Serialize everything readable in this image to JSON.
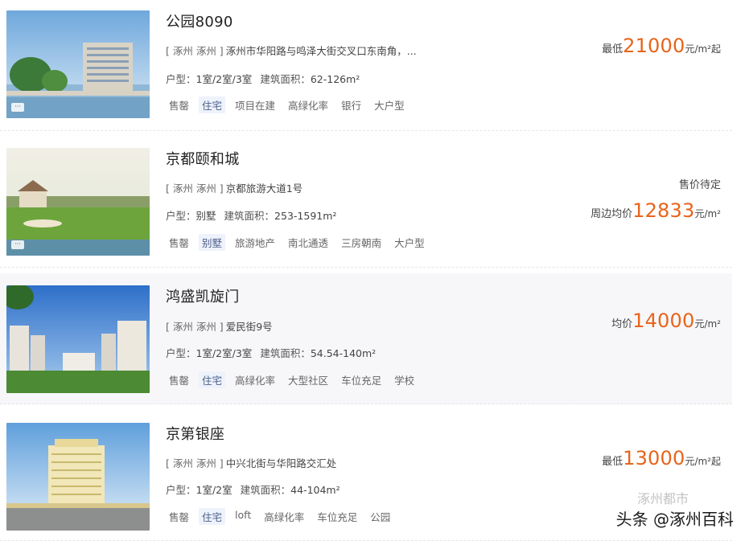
{
  "listings": [
    {
      "name": "公园8090",
      "region": "[ 涿州 涿州 ]",
      "address": "涿州市华阳路与鸣泽大街交叉口东南角，...",
      "spec_label": "户型：",
      "layout": "1室/2室/3室",
      "area_label": "建筑面积：",
      "area": "62-126m²",
      "tags": [
        "售罄",
        "住宅",
        "项目在建",
        "高绿化率",
        "银行",
        "大户型"
      ],
      "price_prefix": "最低",
      "price": "21000",
      "price_unit": "元/m²起",
      "pending": ""
    },
    {
      "name": "京都颐和城",
      "region": "[ 涿州 涿州 ]",
      "address": "京都旅游大道1号",
      "spec_label": "户型：",
      "layout": "别墅",
      "area_label": "建筑面积：",
      "area": "253-1591m²",
      "tags": [
        "售罄",
        "别墅",
        "旅游地产",
        "南北通透",
        "三房朝南",
        "大户型"
      ],
      "price_prefix": "周边均价",
      "price": "12833",
      "price_unit": "元/m²",
      "pending": "售价待定"
    },
    {
      "name": "鸿盛凯旋门",
      "region": "[ 涿州 涿州 ]",
      "address": "爱民街9号",
      "spec_label": "户型：",
      "layout": "1室/2室/3室",
      "area_label": "建筑面积：",
      "area": "54.54-140m²",
      "tags": [
        "售罄",
        "住宅",
        "高绿化率",
        "大型社区",
        "车位充足",
        "学校"
      ],
      "price_prefix": "均价",
      "price": "14000",
      "price_unit": "元/m²",
      "pending": ""
    },
    {
      "name": "京第银座",
      "region": "[ 涿州 涿州 ]",
      "address": "中兴北街与华阳路交汇处",
      "spec_label": "户型：",
      "layout": "1室/2室",
      "area_label": "建筑面积：",
      "area": "44-104m²",
      "tags": [
        "售罄",
        "住宅",
        "loft",
        "高绿化率",
        "车位充足",
        "公园"
      ],
      "price_prefix": "最低",
      "price": "13000",
      "price_unit": "元/m²起",
      "pending": ""
    }
  ],
  "watermark": "头条 @涿州百科",
  "watermark_faint": "涿州都市",
  "badge_glyph": "···",
  "colors": {
    "price": "#e8641b",
    "type_tag_bg": "#eef2fb"
  }
}
